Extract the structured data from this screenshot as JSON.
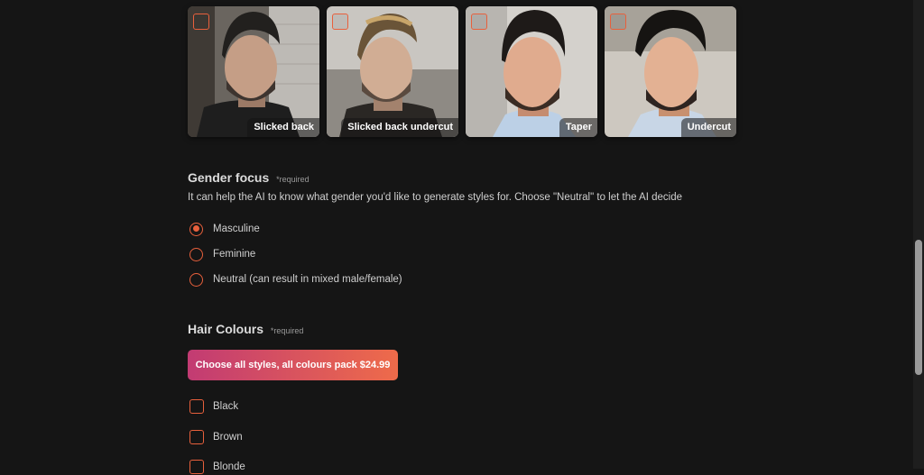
{
  "styles": [
    {
      "label": "Slicked back",
      "selected": false
    },
    {
      "label": "Slicked back undercut",
      "selected": false
    },
    {
      "label": "Taper",
      "selected": false
    },
    {
      "label": "Undercut",
      "selected": false
    }
  ],
  "gender_focus": {
    "title": "Gender focus",
    "required": "*required",
    "description": "It can help the AI to know what gender you'd like to generate styles for. Choose \"Neutral\" to let the AI decide",
    "options": [
      {
        "label": "Masculine",
        "selected": true
      },
      {
        "label": "Feminine",
        "selected": false
      },
      {
        "label": "Neutral (can result in mixed male/female)",
        "selected": false
      }
    ]
  },
  "hair_colours": {
    "title": "Hair Colours",
    "required": "*required",
    "pack_button_label": "Choose all styles, all colours pack $24.99",
    "options": [
      {
        "label": "Black",
        "checked": false
      },
      {
        "label": "Brown",
        "checked": false
      },
      {
        "label": "Blonde",
        "checked": false
      }
    ]
  },
  "colors": {
    "accent": "#e8603c",
    "background": "#151515",
    "button_gradient_start": "#c23b73",
    "button_gradient_end": "#ee6b4a"
  }
}
